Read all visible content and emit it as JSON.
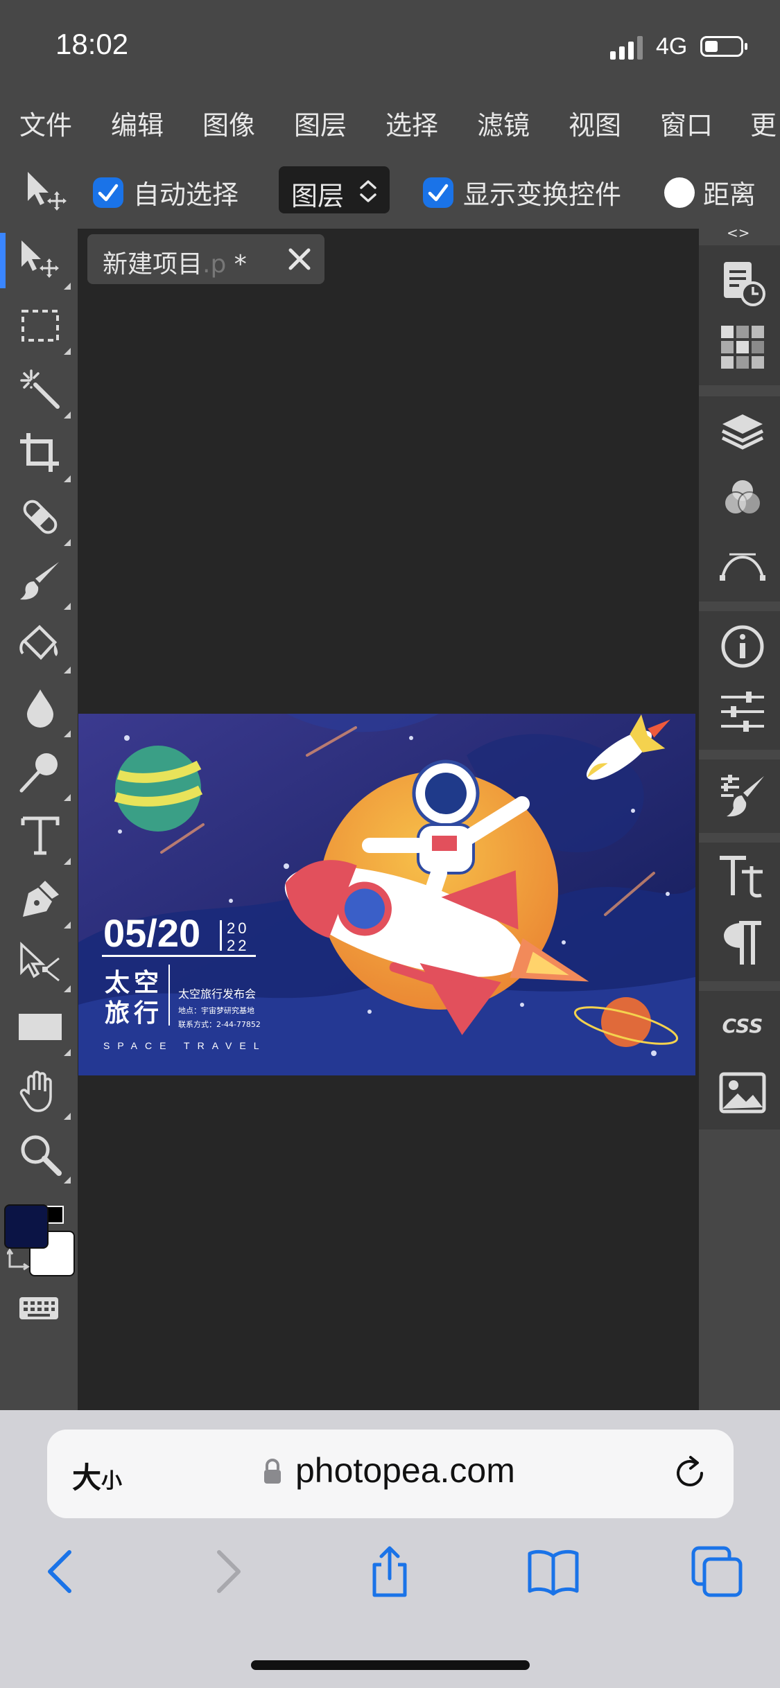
{
  "status_bar": {
    "time": "18:02",
    "network": "4G"
  },
  "menu": [
    "文件",
    "编辑",
    "图像",
    "图层",
    "选择",
    "滤镜",
    "视图",
    "窗口",
    "更"
  ],
  "options": {
    "auto_select_label": "自动选择",
    "auto_select_checked": true,
    "layer_select_value": "图层",
    "show_transform_label": "显示变换控件",
    "show_transform_checked": true,
    "distance_label": "距离",
    "distance_checked": false
  },
  "tools": [
    "move-tool",
    "marquee-tool",
    "magic-wand-tool",
    "crop-tool",
    "healing-tool",
    "brush-tool",
    "paint-bucket-tool",
    "blur-tool",
    "dodge-tool",
    "type-tool",
    "pen-tool",
    "path-select-tool",
    "rectangle-tool",
    "hand-tool",
    "zoom-tool"
  ],
  "colors": {
    "foreground": "#0b1445",
    "background": "#ffffff",
    "accent": "#3a86ff"
  },
  "document_tab": {
    "name": "新建项目",
    "ext": ".p",
    "modified": "*"
  },
  "right_panel": {
    "toggle": "<>",
    "buttons": [
      "history-icon",
      "swatches-icon",
      "layers-icon",
      "channels-icon",
      "paths-icon",
      "info-icon",
      "adjustments-icon",
      "brush-settings-icon",
      "character-icon",
      "paragraph-icon",
      "css-icon",
      "image-icon"
    ],
    "css_label": "CSS"
  },
  "artwork": {
    "date": "05/20",
    "year_top": "20",
    "year_bottom": "22",
    "title_line1": "太空",
    "title_line2": "旅行",
    "event": "太空旅行发布会",
    "location": "地点：宇宙梦研究基地",
    "contact": "联系方式：2-44-77852",
    "subtitle": "SPACE TRAVEL",
    "colors": {
      "bg": "#1b2766",
      "planet": "#f3a73a",
      "rocket_red": "#e2505c"
    }
  },
  "browser": {
    "text_size_label": "大",
    "text_size_small": "小",
    "url": "photopea.com"
  }
}
